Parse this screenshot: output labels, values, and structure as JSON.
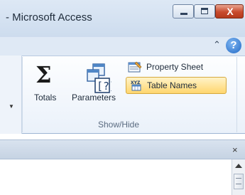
{
  "window": {
    "title": "- Microsoft Access",
    "controls": {
      "minimize": "minimize",
      "maximize": "maximize",
      "close": "X"
    }
  },
  "ribbon": {
    "tabs_row": {
      "collapse_icon": "caret-up-icon",
      "help": "?"
    },
    "commands": {
      "totals": {
        "label": "Totals",
        "icon": "sigma-icon"
      },
      "parameters": {
        "label": "Parameters",
        "icon": "parameters-icon"
      },
      "property_sheet": {
        "label": "Property Sheet",
        "icon": "property-sheet-icon"
      },
      "table_names": {
        "label": "Table Names",
        "icon": "table-names-icon",
        "state": "active"
      }
    },
    "group_label": "Show/Hide"
  },
  "document": {
    "close": "×"
  },
  "colors": {
    "accent": "#2169c5",
    "highlight": "#ffd66e",
    "title_bar": "#dde8f5"
  }
}
